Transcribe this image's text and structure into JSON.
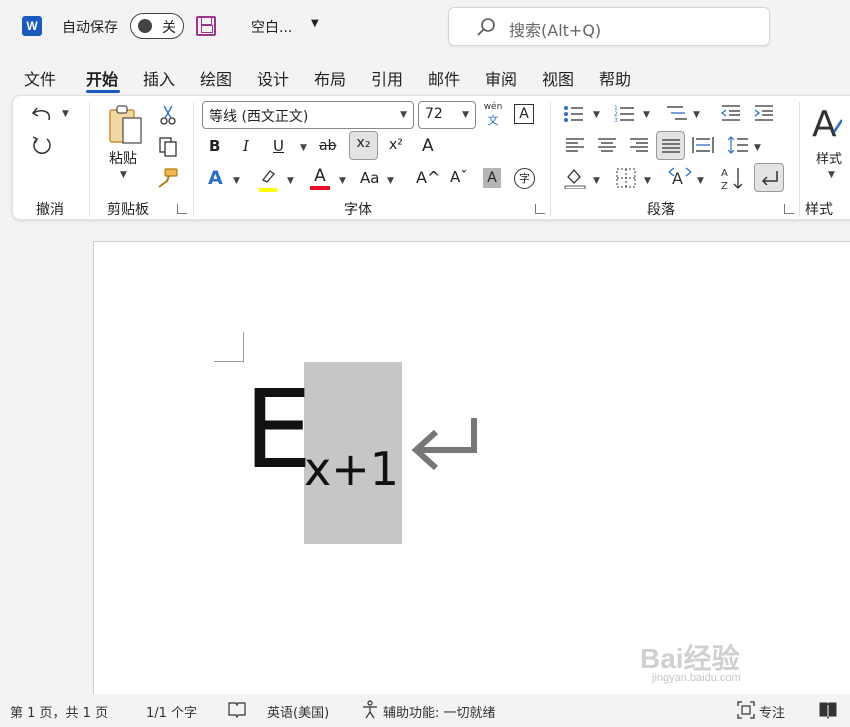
{
  "titlebar": {
    "app_icon_letter": "W",
    "autosave_label": "自动保存",
    "autosave_state": "关",
    "doc_title": "空白...",
    "search_placeholder": "搜索(Alt+Q)"
  },
  "tabs": [
    "文件",
    "开始",
    "插入",
    "绘图",
    "设计",
    "布局",
    "引用",
    "邮件",
    "审阅",
    "视图",
    "帮助"
  ],
  "active_tab": "开始",
  "ribbon": {
    "undo_group": "撤消",
    "clipboard": {
      "paste": "粘贴",
      "group": "剪贴板"
    },
    "font": {
      "font_name": "等线 (西文正文)",
      "font_size": "72",
      "phonetic_top": "wén",
      "phonetic_bottom": "文",
      "border_char": "A",
      "bold": "B",
      "italic": "I",
      "underline": "U",
      "strike": "ab",
      "subscript": "x₂",
      "superscript": "x²",
      "clear_fmt": "A",
      "text_effect": "A",
      "font_color": "A",
      "change_case": "Aa",
      "grow": "A^",
      "shrink": "Aˇ",
      "shade": "A",
      "enclose": "字",
      "group": "字体"
    },
    "paragraph": {
      "group": "段落"
    },
    "styles": {
      "label": "样式",
      "group": "样式"
    }
  },
  "document": {
    "base": "E",
    "subscript": "x+1"
  },
  "status": {
    "page": "第 1 页，共 1 页",
    "words": "1/1 个字",
    "language": "英语(美国)",
    "accessibility": "辅助功能: 一切就绪",
    "focus": "专注"
  },
  "watermark": {
    "brand": "Bai经验",
    "url": "jingyan.baidu.com"
  },
  "colors": {
    "accent": "#185abd",
    "highlight": "#ffff00",
    "font_red": "#e81123",
    "save_purple": "#a0338e"
  }
}
